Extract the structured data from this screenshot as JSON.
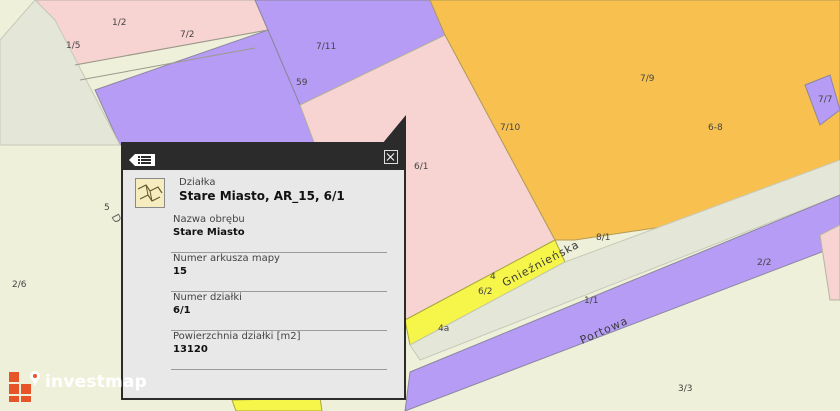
{
  "map": {
    "parcel_labels": [
      "1/2",
      "7/2",
      "1/5",
      "7/11",
      "59",
      "7/9",
      "7/7",
      "6-8",
      "7/10",
      "6/1",
      "5",
      "D",
      "2/6",
      "8/1",
      "4",
      "6/2",
      "4a",
      "2/2",
      "1/1",
      "3/3"
    ],
    "streets": [
      "Gnieźnieńska",
      "Portowa"
    ],
    "colors": {
      "background": "#eef0d9",
      "parcel_pink": "#f7d3d1",
      "parcel_violet": "#b69cf5",
      "parcel_orange": "#f8c14f",
      "parcel_yellow": "#f6f54a",
      "road": "#e4e7d7"
    }
  },
  "popup": {
    "kind": "Działka",
    "title": "Stare Miasto, AR_15, 6/1",
    "fields": [
      {
        "label": "Nazwa obrębu",
        "value": "Stare Miasto"
      },
      {
        "label": "Numer arkusza mapy",
        "value": "15"
      },
      {
        "label": "Numer działki",
        "value": "6/1"
      },
      {
        "label": "Powierzchnia działki [m2]",
        "value": "13120"
      }
    ],
    "menu_icon": "list-menu-icon",
    "close_icon": "close-icon",
    "thumbnail_icon": "parcel-map-thumbnail-icon"
  },
  "brand": {
    "name": "investmap",
    "logo_color": "#e8542a"
  }
}
